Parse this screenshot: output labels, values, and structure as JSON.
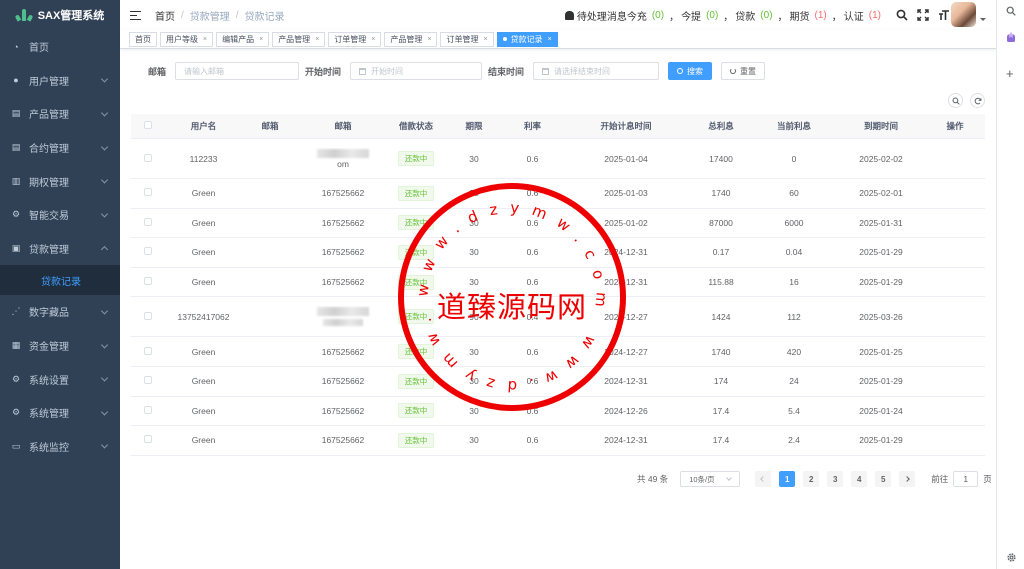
{
  "app": {
    "title": "SAX管理系统"
  },
  "sidebar": {
    "items": [
      {
        "label": "首页",
        "icon": "dashboard-icon",
        "expandable": false
      },
      {
        "label": "用户管理",
        "icon": "user-icon",
        "expandable": true
      },
      {
        "label": "产品管理",
        "icon": "document-icon",
        "expandable": true
      },
      {
        "label": "合约管理",
        "icon": "document-icon",
        "expandable": true
      },
      {
        "label": "期权管理",
        "icon": "list-icon",
        "expandable": true
      },
      {
        "label": "智能交易",
        "icon": "gear-icon",
        "expandable": true
      },
      {
        "label": "贷款管理",
        "icon": "money-icon",
        "expandable": true,
        "open": true
      }
    ],
    "sub_item": "贷款记录",
    "items_after": [
      {
        "label": "数字藏品",
        "icon": "chart-icon"
      },
      {
        "label": "资金管理",
        "icon": "wallet-icon"
      },
      {
        "label": "系统设置",
        "icon": "gear-icon"
      },
      {
        "label": "系统管理",
        "icon": "gear-icon"
      },
      {
        "label": "系统监控",
        "icon": "monitor-icon"
      }
    ]
  },
  "header": {
    "breadcrumb": [
      "首页",
      "贷款管理",
      "贷款记录"
    ],
    "notice_label": "待处理消息",
    "notices": [
      {
        "label": "今充",
        "count": "(0)",
        "color": "green"
      },
      {
        "label": "今提",
        "count": "(0)",
        "color": "green"
      },
      {
        "label": "贷款",
        "count": "(0)",
        "color": "green"
      },
      {
        "label": "期货",
        "count": "(1)",
        "color": "red"
      },
      {
        "label": "认证",
        "count": "(1)",
        "color": "red"
      }
    ]
  },
  "tabs": [
    {
      "label": "首页",
      "closable": false
    },
    {
      "label": "用户等级",
      "closable": true
    },
    {
      "label": "编辑产品",
      "closable": true
    },
    {
      "label": "产品管理",
      "closable": true
    },
    {
      "label": "订单管理",
      "closable": true
    },
    {
      "label": "产品管理",
      "closable": true
    },
    {
      "label": "订单管理",
      "closable": true
    },
    {
      "label": "贷款记录",
      "closable": true,
      "active": true
    }
  ],
  "filters": {
    "email_label": "邮箱",
    "email_placeholder": "请输入邮箱",
    "start_label": "开始时间",
    "start_placeholder": "开始时间",
    "end_label": "结束时间",
    "end_placeholder": "请选择结束时间",
    "search_label": "搜索",
    "reset_label": "重置"
  },
  "table": {
    "columns": [
      "用户名",
      "邮箱",
      "邮箱",
      "借款状态",
      "期限",
      "利率",
      "开始计息时间",
      "总利息",
      "当前利息",
      "到期时间",
      "操作"
    ],
    "rows": [
      {
        "username": "112233",
        "email1": "",
        "email2": "om",
        "email2_blur": true,
        "status": "还款中",
        "term": "30",
        "rate": "0.6",
        "start": "2025-01-04",
        "total": "17400",
        "current": "0",
        "due": "2025-02-02",
        "tall": true
      },
      {
        "username": "Green",
        "email1": "",
        "email2": "167525662",
        "status": "还款中",
        "term": "30",
        "rate": "0.6",
        "start": "2025-01-03",
        "total": "1740",
        "current": "60",
        "due": "2025-02-01"
      },
      {
        "username": "Green",
        "email1": "",
        "email2": "167525662",
        "status": "还款中",
        "term": "30",
        "rate": "0.6",
        "start": "2025-01-02",
        "total": "87000",
        "current": "6000",
        "due": "2025-01-31"
      },
      {
        "username": "Green",
        "email1": "",
        "email2": "167525662",
        "status": "还款中",
        "term": "30",
        "rate": "0.6",
        "start": "2024-12-31",
        "total": "0.17",
        "current": "0.04",
        "due": "2025-01-29"
      },
      {
        "username": "Green",
        "email1": "",
        "email2": "167525662",
        "status": "还款中",
        "term": "30",
        "rate": "0.6",
        "start": "2024-12-31",
        "total": "115.88",
        "current": "16",
        "due": "2025-01-29"
      },
      {
        "username": "13752417062",
        "email1": "",
        "email2": "",
        "email2_blur": true,
        "status": "还款中",
        "term": "90",
        "rate": "0.4",
        "start": "2024-12-27",
        "total": "1424",
        "current": "112",
        "due": "2025-03-26",
        "tall": true
      },
      {
        "username": "Green",
        "email1": "",
        "email2": "167525662",
        "status": "还款中",
        "term": "30",
        "rate": "0.6",
        "start": "2024-12-27",
        "total": "1740",
        "current": "420",
        "due": "2025-01-25"
      },
      {
        "username": "Green",
        "email1": "",
        "email2": "167525662",
        "status": "还款中",
        "term": "30",
        "rate": "0.6",
        "start": "2024-12-31",
        "total": "174",
        "current": "24",
        "due": "2025-01-29"
      },
      {
        "username": "Green",
        "email1": "",
        "email2": "167525662",
        "status": "还款中",
        "term": "30",
        "rate": "0.6",
        "start": "2024-12-26",
        "total": "17.4",
        "current": "5.4",
        "due": "2025-01-24"
      },
      {
        "username": "Green",
        "email1": "",
        "email2": "167525662",
        "status": "还款中",
        "term": "30",
        "rate": "0.6",
        "start": "2024-12-31",
        "total": "17.4",
        "current": "2.4",
        "due": "2025-01-29"
      }
    ]
  },
  "pagination": {
    "total_text": "共 49 条",
    "page_size": "10条/页",
    "pages": [
      "1",
      "2",
      "3",
      "4",
      "5"
    ],
    "current_page": "1",
    "goto_prefix": "前往",
    "goto_value": "1",
    "goto_suffix": "页"
  },
  "watermark": {
    "text": "道臻源码网",
    "ring_text": "www.dzymw.com www.dzymw.com"
  }
}
